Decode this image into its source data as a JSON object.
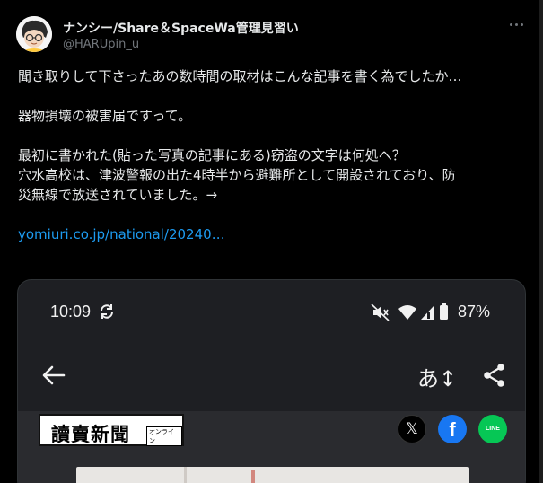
{
  "author": {
    "display_name": "ナンシー/Share＆SpaceWa管理見習い",
    "handle": "@HARUpin_u"
  },
  "tweet": {
    "lines": [
      "聞き取りして下さったあの数時間の取材はこんな記事を書く為でしたか…",
      "",
      "器物損壊の被害届ですって。",
      "",
      "最初に書かれた(貼った写真の記事にある)窃盗の文字は何処へ？",
      "穴水高校は、津波警報の出た4時半から避難所として開設されており、防",
      "災無線で放送されていました。→",
      ""
    ],
    "link_text": "yomiuri.co.jp/national/20240…"
  },
  "media": {
    "status_bar": {
      "time": "10:09",
      "battery": "87%"
    },
    "app_bar": {
      "font_size_label": "あ↕"
    },
    "site": {
      "logo_text": "讀賣新聞",
      "logo_badge": "オンライン",
      "share_icons": [
        "x-icon",
        "facebook-icon",
        "line-icon"
      ],
      "x_glyph": "𝕏",
      "fb_glyph": "f",
      "line_glyph": "LINE"
    }
  },
  "colors": {
    "background": "#000000",
    "text": "#e7e9ea",
    "muted": "#71767b",
    "link": "#1d9bf0",
    "facebook": "#1877f2",
    "line": "#06c755"
  }
}
